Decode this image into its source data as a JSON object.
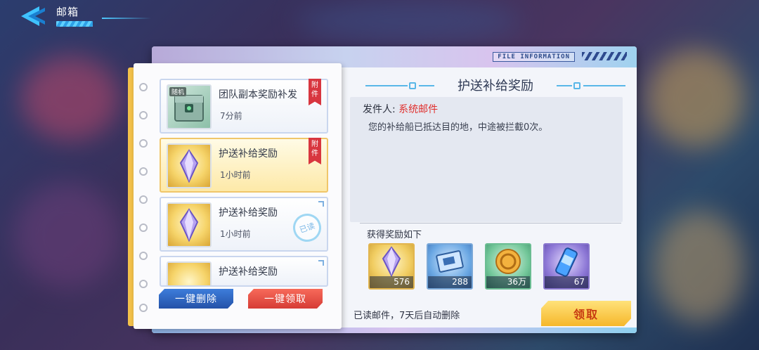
{
  "header": {
    "title": "邮箱"
  },
  "panel": {
    "file_info": "FILE INFORMATION"
  },
  "mail_list": [
    {
      "title": "团队副本奖励补发",
      "time": "7分前",
      "thumb_tag": "随机",
      "attachment_tag": "附件",
      "read_stamp": "",
      "selected": false
    },
    {
      "title": "护送补给奖励",
      "time": "1小时前",
      "thumb_tag": "",
      "attachment_tag": "附件",
      "read_stamp": "",
      "selected": true
    },
    {
      "title": "护送补给奖励",
      "time": "1小时前",
      "thumb_tag": "",
      "attachment_tag": "",
      "read_stamp": "已读",
      "selected": false
    },
    {
      "title": "护送补给奖励",
      "time": "",
      "thumb_tag": "",
      "attachment_tag": "",
      "read_stamp": "",
      "selected": false
    }
  ],
  "actions": {
    "delete_all": "一键删除",
    "claim_all": "一键领取"
  },
  "detail": {
    "title": "护送补给奖励",
    "sender_label": "发件人:",
    "sender_name": "系统邮件",
    "body": "您的补给船已抵达目的地，中途被拦截0次。",
    "rewards_heading": "获得奖励如下",
    "rewards": [
      {
        "icon": "crystal-icon",
        "qty": "576"
      },
      {
        "icon": "chip-card-icon",
        "qty": "288"
      },
      {
        "icon": "coin-icon",
        "qty": "36万"
      },
      {
        "icon": "energy-can-icon",
        "qty": "67"
      }
    ],
    "auto_delete_note": "已读邮件，7天后自动删除",
    "claim_label": "领取"
  },
  "colors": {
    "accent_blue": "#2452a8",
    "accent_red": "#d63c35",
    "sender_red": "#e0302e",
    "claim_gold": "#f6b72b"
  }
}
